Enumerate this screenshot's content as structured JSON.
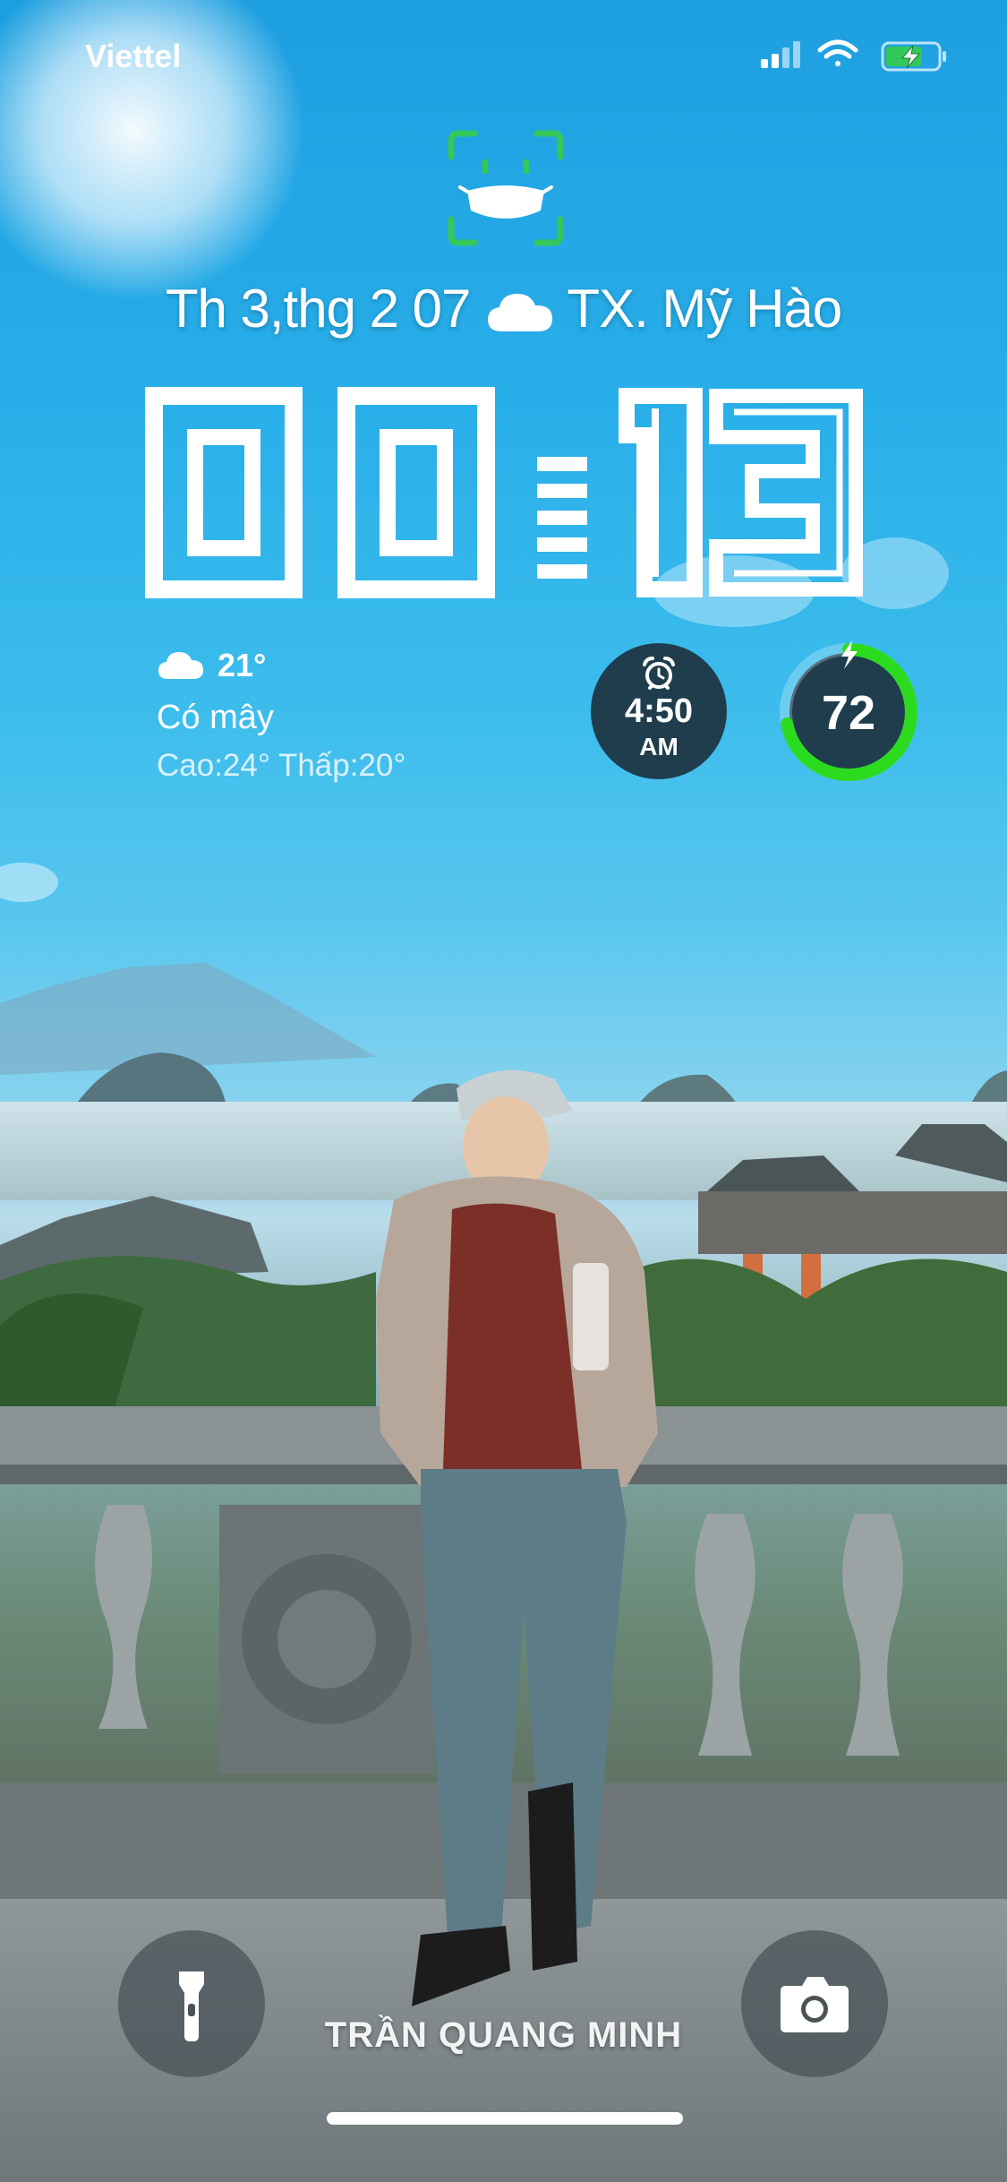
{
  "status_bar": {
    "carrier": "Viettel",
    "icons": [
      "cellular-signal-icon",
      "wifi-icon",
      "battery-charging-icon"
    ]
  },
  "lock_icon": "face-id-mask-icon",
  "date_line": {
    "date": "Th 3,thg 2 07",
    "weather_icon": "cloud-icon",
    "location": "TX. Mỹ Hào"
  },
  "clock": {
    "time": "00:13",
    "digits": [
      "0",
      "0",
      "1",
      "3"
    ]
  },
  "weather_widget": {
    "icon": "cloud-icon",
    "temperature": "21°",
    "condition": "Có mây",
    "high_low": "Cao:24° Thấp:20°"
  },
  "alarm_widget": {
    "icon": "alarm-clock-icon",
    "time": "4:50",
    "period": "AM"
  },
  "battery_widget": {
    "icon": "charging-bolt-icon",
    "level": "72",
    "fraction": 0.72,
    "ring_color": "#2bdc1e"
  },
  "quick_actions": {
    "left": "flashlight-icon",
    "right": "camera-icon"
  },
  "owner_name": "TRẦN QUANG MINH",
  "colors": {
    "sky": "#2aaae6",
    "widget_dark": "#1f3d4c",
    "face_id_green": "#34c759"
  }
}
